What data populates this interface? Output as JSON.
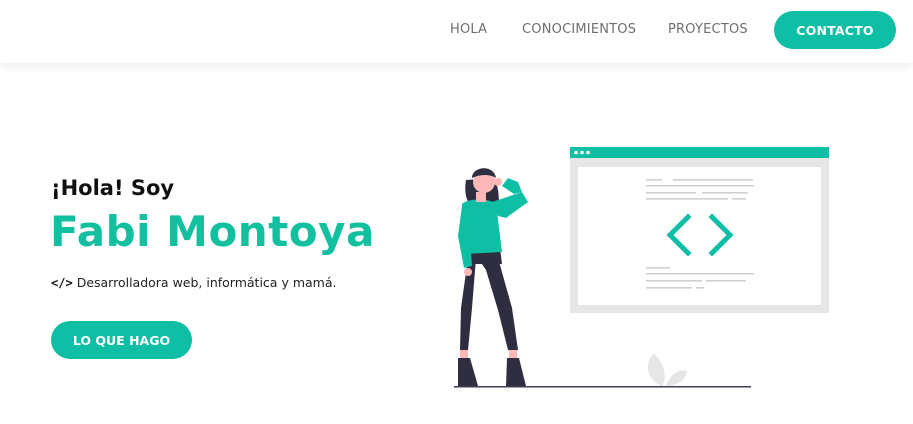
{
  "nav": {
    "links": [
      "HOLA",
      "CONOCIMIENTOS",
      "PROYECTOS"
    ],
    "cta_label": "CONTACTO"
  },
  "hero": {
    "greeting": "¡Hola! Soy",
    "name": "Fabi Montoya",
    "tagline_icon": "code-icon",
    "tagline": "Desarrolladora web, informática y mamá.",
    "cta_label": "LO QUE HAGO"
  },
  "colors": {
    "accent": "#0fbfa5",
    "text_dark": "#111111",
    "nav_text": "#6e6e6e",
    "illustration_gray": "#e6e6e6",
    "figure_dark": "#2f2e41"
  }
}
